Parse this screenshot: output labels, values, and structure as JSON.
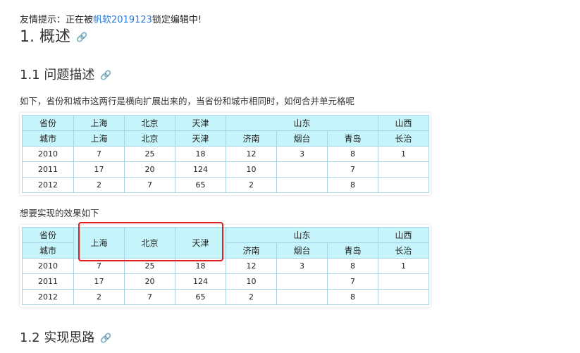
{
  "notice": {
    "prefix": "友情提示：正在被",
    "user": "帆软2019123",
    "suffix": "锁定编辑中!"
  },
  "headings": {
    "h1": "1. 概述",
    "h2_problem": "1.1 问题描述",
    "h2_solution": "1.2 实现思路"
  },
  "paragraphs": {
    "intro": "如下，省份和城市这两行是横向扩展出来的，当省份和城市相同时，如何合并单元格呢",
    "effect": "想要实现的效果如下"
  },
  "table1": {
    "province_row": [
      "省份",
      "上海",
      "北京",
      "天津",
      "山东",
      "山西"
    ],
    "city_row": [
      "城市",
      "上海",
      "北京",
      "天津",
      "济南",
      "烟台",
      "青岛",
      "长治"
    ],
    "data_rows": [
      [
        "2010",
        "7",
        "25",
        "18",
        "12",
        "3",
        "8",
        "1"
      ],
      [
        "2011",
        "17",
        "20",
        "124",
        "10",
        "",
        "7",
        ""
      ],
      [
        "2012",
        "2",
        "7",
        "65",
        "2",
        "",
        "8",
        ""
      ]
    ]
  },
  "table2": {
    "province_row": [
      "省份",
      "上海",
      "北京",
      "天津",
      "山东",
      "山西"
    ],
    "city_row": [
      "城市",
      "济南",
      "烟台",
      "青岛",
      "长治"
    ],
    "data_rows": [
      [
        "2010",
        "7",
        "25",
        "18",
        "12",
        "3",
        "8",
        "1"
      ],
      [
        "2011",
        "17",
        "20",
        "124",
        "10",
        "",
        "7",
        ""
      ],
      [
        "2012",
        "2",
        "7",
        "65",
        "2",
        "",
        "8",
        ""
      ]
    ]
  },
  "colors": {
    "header_bg": "#c6f4fb",
    "border": "#a9d3e6",
    "link": "#2b7bd6",
    "highlight": "#e02020"
  },
  "icons": {
    "anchor": "link-icon"
  }
}
